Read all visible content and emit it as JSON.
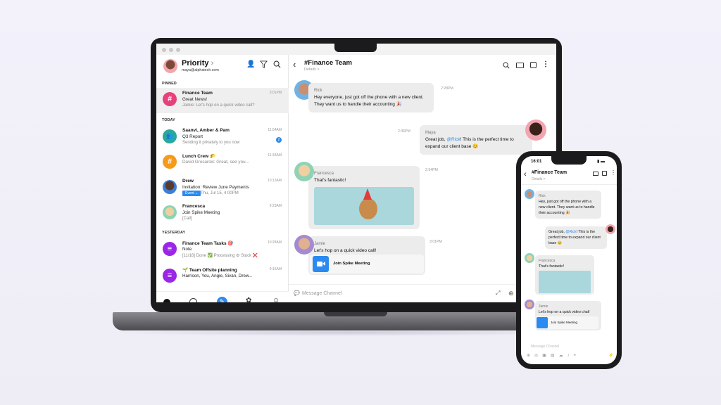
{
  "desktop": {
    "sidebar": {
      "title": "Priority",
      "email": "maya@alphatech.com",
      "sections": {
        "pinned": "PINNED",
        "today": "TODAY",
        "yesterday": "YESTERDAY"
      },
      "items": [
        {
          "name": "Finance Team",
          "line2": "Great News!",
          "line3": "Jamie: Let's hop on a quick video call?",
          "time": "3:01PM",
          "avatar": "#",
          "color": "#e8407a"
        },
        {
          "name": "Saanvi, Amber & Pam",
          "line2": "Q3 Report",
          "line3": "Sending it privately to you now",
          "time": "11:54AM",
          "badge": "2",
          "color": "#2aa89a"
        },
        {
          "name": "Lunch Crew 🌮",
          "line3": "David Grosarski: Great, see you...",
          "time": "11:33AM",
          "avatar": "#",
          "color": "#f59a1b"
        },
        {
          "name": "Drew",
          "line2": "Invitation: Review June Payments",
          "event": "Event",
          "line3": "Thu, Jul 15, 4:00PM",
          "time": "10:13AM",
          "color": "#3b7fd6"
        },
        {
          "name": "Francesca",
          "line2": "Join Spike Meeting",
          "line3": "[Call]",
          "time": "9:23AM",
          "color": "#8fd3b4"
        },
        {
          "name": "Finance Team Tasks 🎯",
          "line2": "Note",
          "line3": "[11/16] Done ✅ Processing ⚙ Stuck ❌",
          "time": "10:28AM",
          "color": "#9b27e6"
        },
        {
          "name": "🌱 Team Offsite planning",
          "line2": "Harrison, You, Angie, Sivan, Drew...",
          "time": "9:16AM",
          "color": "#9b27e6"
        }
      ]
    },
    "chat": {
      "title": "#Finance Team",
      "subtitle": "Details >",
      "messages": [
        {
          "sender": "Rick",
          "text": "Hey everyone, just got off the phone with a new client. They want us to handle their accounting 🎉",
          "time": "2:28PM"
        },
        {
          "sender": "Maya",
          "text_pre": "Great job, ",
          "mention": "@Rick",
          "text_post": "! This is the perfect time to expand our client base 😊",
          "time": "2:36PM"
        },
        {
          "sender": "Francesca",
          "text": "That's fantastic!",
          "time": "2:54PM"
        },
        {
          "sender": "Jamie",
          "text": "Let's hop on a quick video call!",
          "time": "3:01PM",
          "meeting": "Join Spike Meeting"
        }
      ],
      "input_placeholder": "Message Channel"
    }
  },
  "phone": {
    "time": "16:01",
    "title": "#Finance Team",
    "subtitle": "Details >",
    "messages": [
      {
        "sender": "Rick",
        "text": "Hey, just got off the phone with a new client. They want us to handle their accounting 🎉"
      },
      {
        "text_pre": "Great job, ",
        "mention": "@Rick",
        "text_post": "! This is the perfect time to expand our client base 😊"
      },
      {
        "sender": "Francesca",
        "text": "That's fantastic!"
      },
      {
        "sender": "Jamie",
        "text": "Let's hop on a quick video chat!",
        "meeting": "Join Spike Meeting"
      }
    ],
    "input_placeholder": "Message Channel"
  },
  "colors": {
    "accent": "#2b8af0",
    "background": "#f1eff8"
  }
}
